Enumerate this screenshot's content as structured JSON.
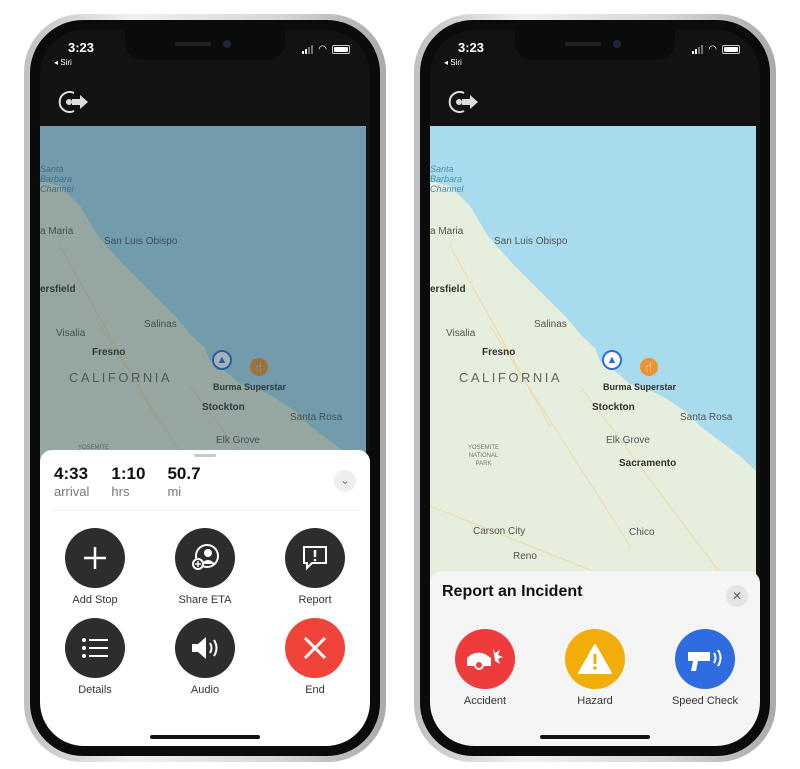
{
  "status": {
    "time": "3:23",
    "back": "◂ Siri"
  },
  "map": {
    "labels": {
      "sea": "Santa\nBarbara\nChannel",
      "santa_maria": "a Maria",
      "slo": "San Luis Obispo",
      "bakersfield": "ersfield",
      "salinas": "Salinas",
      "visalia": "Visalia",
      "fresno": "Fresno",
      "state": "CALIFORNIA",
      "destination": "Burma Superstar",
      "stockton": "Stockton",
      "santa_rosa": "Santa Rosa",
      "elk_grove": "Elk Grove",
      "park": "YOSEMITE\nNATIONAL\nPARK",
      "sacramento": "Sacramento",
      "carson_city": "Carson City",
      "chico": "Chico",
      "reno": "Reno"
    },
    "colors": {
      "water": "#a8dbee",
      "land": "#e6eedd"
    }
  },
  "left": {
    "trip": {
      "arrival": "4:33",
      "arrival_label": "arrival",
      "duration": "1:10",
      "duration_label": "hrs",
      "distance": "50.7",
      "distance_label": "mi"
    },
    "actions": [
      "Add Stop",
      "Share ETA",
      "Report",
      "Details",
      "Audio",
      "End"
    ],
    "end_color": "#f0433a"
  },
  "right": {
    "title": "Report an Incident",
    "incidents": [
      {
        "label": "Accident",
        "color": "#ee3b3b"
      },
      {
        "label": "Hazard",
        "color": "#f2ad0b"
      },
      {
        "label": "Speed Check",
        "color": "#2f6ce0"
      }
    ]
  }
}
